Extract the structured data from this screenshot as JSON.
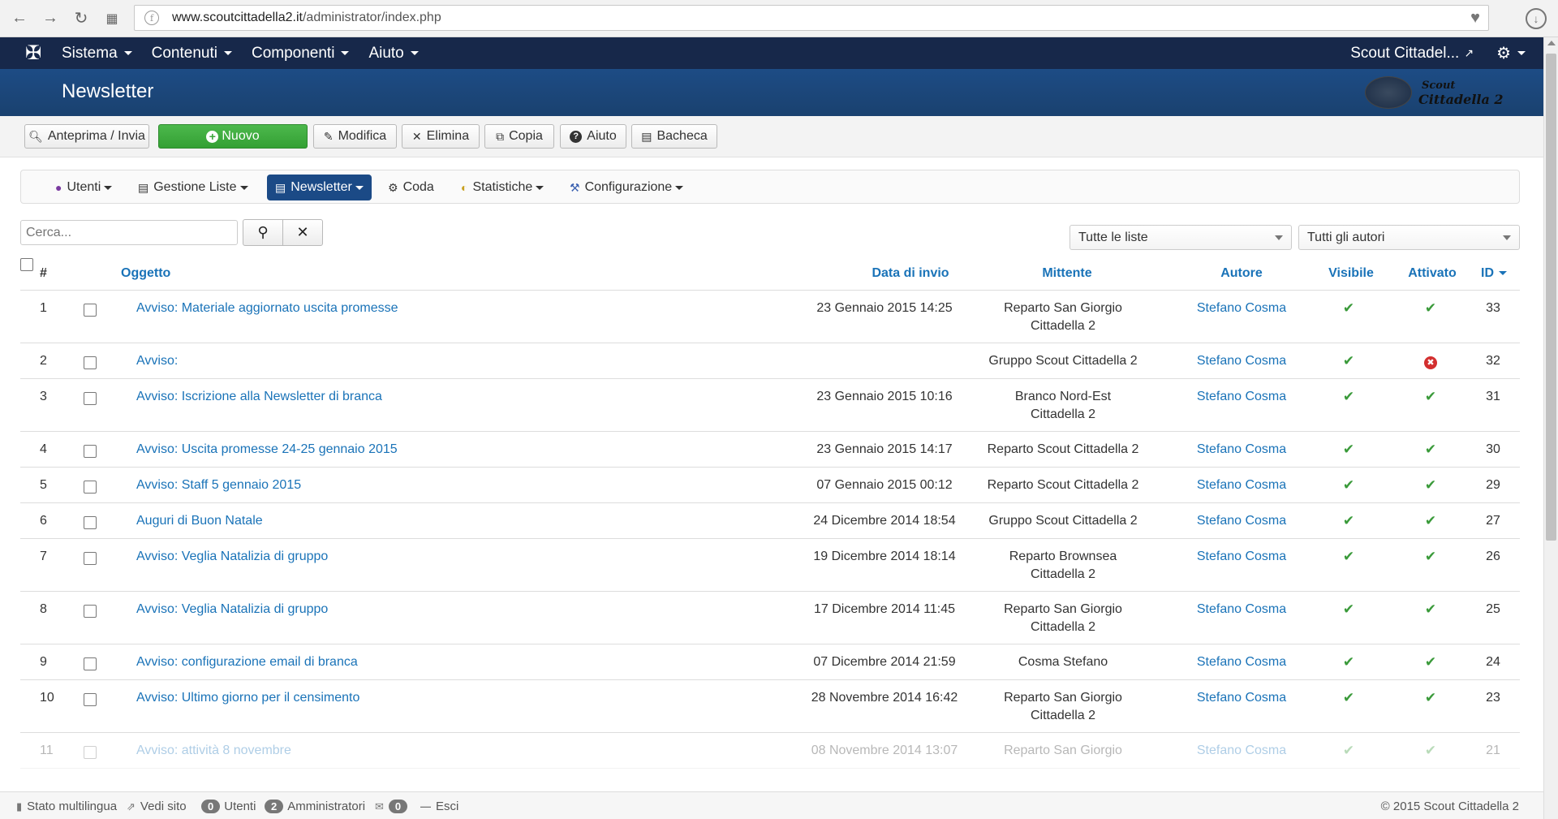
{
  "browser": {
    "url_domain": "www.scoutcittadella2.it",
    "url_path": "/administrator/index.php"
  },
  "navbar": {
    "menus": [
      "Sistema",
      "Contenuti",
      "Componenti",
      "Aiuto"
    ],
    "site_link": "Scout Cittadel...",
    "accent": "#17284a"
  },
  "title": {
    "page": "Newsletter",
    "logo_line1": "Scout",
    "logo_line2": "Cittadella 2"
  },
  "toolbar": {
    "preview": "Anteprima / Invia",
    "new": "Nuovo",
    "edit": "Modifica",
    "delete": "Elimina",
    "copy": "Copia",
    "help": "Aiuto",
    "trash": "Bacheca",
    "new_color": "#3aa63a"
  },
  "submenu": {
    "users": "Utenti",
    "lists": "Gestione Liste",
    "newsletter": "Newsletter",
    "queue": "Coda",
    "stats": "Statistiche",
    "config": "Configurazione"
  },
  "search": {
    "placeholder": "Cerca...",
    "list_filter": "Tutte le liste",
    "author_filter": "Tutti gli autori"
  },
  "table": {
    "headers": {
      "num": "#",
      "subject": "Oggetto",
      "date": "Data di invio",
      "sender": "Mittente",
      "author": "Autore",
      "visible": "Visibile",
      "active": "Attivato",
      "id": "ID"
    },
    "rows": [
      {
        "num": "1",
        "subject": "Avviso: Materiale aggiornato uscita promesse",
        "date": "23 Gennaio 2015 14:25",
        "sender": "Reparto San Giorgio Cittadella 2",
        "author": "Stefano Cosma",
        "visible": "✔",
        "active": "✔",
        "id": "33"
      },
      {
        "num": "2",
        "subject": "Avviso:",
        "date": "",
        "sender": "Gruppo Scout Cittadella 2",
        "author": "Stefano Cosma",
        "visible": "✔",
        "active": "✖",
        "id": "32"
      },
      {
        "num": "3",
        "subject": "Avviso: Iscrizione alla Newsletter di branca",
        "date": "23 Gennaio 2015 10:16",
        "sender": "Branco Nord-Est Cittadella 2",
        "author": "Stefano Cosma",
        "visible": "✔",
        "active": "✔",
        "id": "31"
      },
      {
        "num": "4",
        "subject": "Avviso: Uscita promesse 24-25 gennaio 2015",
        "date": "23 Gennaio 2015 14:17",
        "sender": "Reparto Scout Cittadella 2",
        "author": "Stefano Cosma",
        "visible": "✔",
        "active": "✔",
        "id": "30"
      },
      {
        "num": "5",
        "subject": "Avviso: Staff 5 gennaio 2015",
        "date": "07 Gennaio 2015 00:12",
        "sender": "Reparto Scout Cittadella 2",
        "author": "Stefano Cosma",
        "visible": "✔",
        "active": "✔",
        "id": "29"
      },
      {
        "num": "6",
        "subject": "Auguri di Buon Natale",
        "date": "24 Dicembre 2014 18:54",
        "sender": "Gruppo Scout Cittadella 2",
        "author": "Stefano Cosma",
        "visible": "✔",
        "active": "✔",
        "id": "27"
      },
      {
        "num": "7",
        "subject": "Avviso: Veglia Natalizia di gruppo",
        "date": "19 Dicembre 2014 18:14",
        "sender": "Reparto Brownsea Cittadella 2",
        "author": "Stefano Cosma",
        "visible": "✔",
        "active": "✔",
        "id": "26"
      },
      {
        "num": "8",
        "subject": "Avviso: Veglia Natalizia di gruppo",
        "date": "17 Dicembre 2014 11:45",
        "sender": "Reparto San Giorgio Cittadella 2",
        "author": "Stefano Cosma",
        "visible": "✔",
        "active": "✔",
        "id": "25"
      },
      {
        "num": "9",
        "subject": "Avviso: configurazione email di branca",
        "date": "07 Dicembre 2014 21:59",
        "sender": "Cosma Stefano",
        "author": "Stefano Cosma",
        "visible": "✔",
        "active": "✔",
        "id": "24"
      },
      {
        "num": "10",
        "subject": "Avviso: Ultimo giorno per il censimento",
        "date": "28 Novembre 2014 16:42",
        "sender": "Reparto San Giorgio Cittadella 2",
        "author": "Stefano Cosma",
        "visible": "✔",
        "active": "✔",
        "id": "23"
      },
      {
        "num": "11",
        "subject": "Avviso: attività 8 novembre",
        "date": "08 Novembre 2014 13:07",
        "sender": "Reparto San Giorgio",
        "author": "Stefano Cosma",
        "visible": "✔",
        "active": "✔",
        "id": "21"
      }
    ]
  },
  "status": {
    "multilang": "Stato multilingua",
    "view_site": "Vedi sito",
    "users_count": "0",
    "users_label": "Utenti",
    "admins_count": "2",
    "admins_label": "Amministratori",
    "msg_count": "0",
    "logout": "Esci",
    "copyright": "© 2015 Scout Cittadella 2"
  }
}
